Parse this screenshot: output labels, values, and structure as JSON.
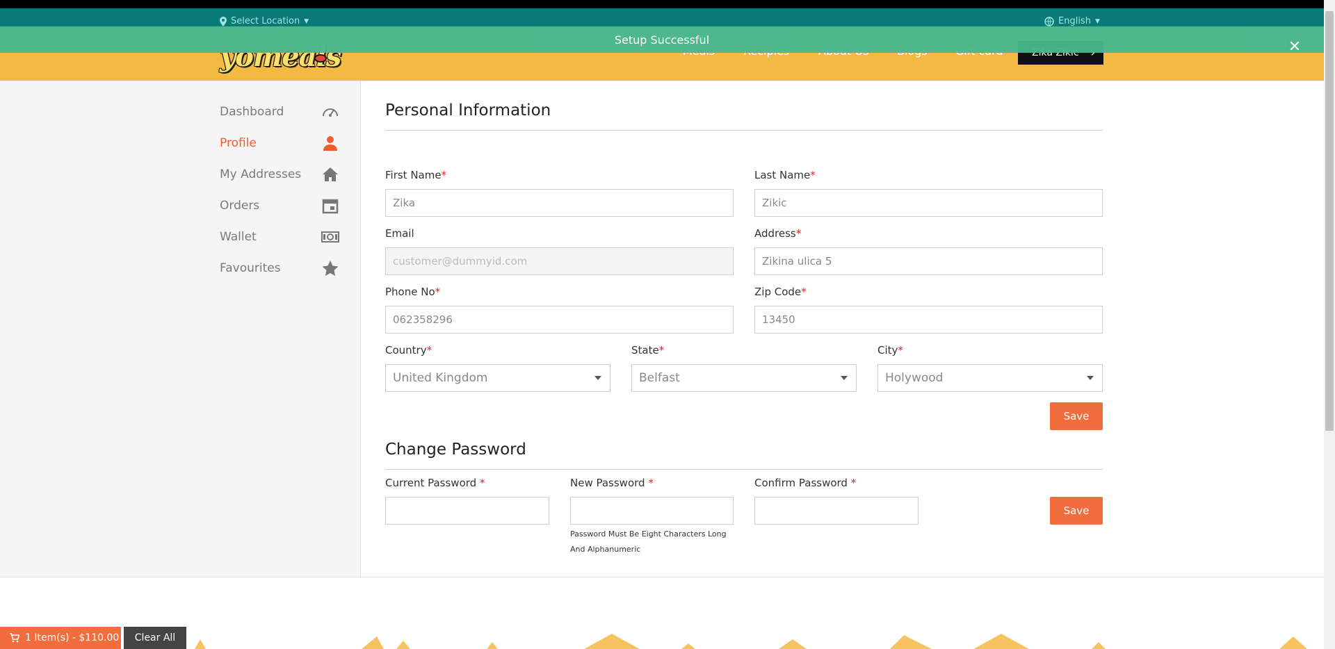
{
  "topbar": {
    "location_label": "Select Location",
    "language_label": "English"
  },
  "toast": {
    "message": "Setup Successful"
  },
  "header": {
    "logo_text": "yomeals",
    "nav": [
      "Meals",
      "Recipies",
      "About Us",
      "Blogs",
      "Gift card"
    ],
    "user_button": "Zika Zikic"
  },
  "sidebar": {
    "items": [
      {
        "label": "Dashboard",
        "icon": "speedometer-icon"
      },
      {
        "label": "Profile",
        "icon": "user-icon"
      },
      {
        "label": "My Addresses",
        "icon": "home-icon"
      },
      {
        "label": "Orders",
        "icon": "calendar-icon"
      },
      {
        "label": "Wallet",
        "icon": "money-icon"
      },
      {
        "label": "Favourites",
        "icon": "star-icon"
      }
    ]
  },
  "personal": {
    "title": "Personal Information",
    "first_name_label": "First Name",
    "first_name_value": "Zika",
    "last_name_label": "Last Name",
    "last_name_value": "Zikic",
    "email_label": "Email",
    "email_value": "customer@dummyid.com",
    "address_label": "Address",
    "address_value": "Zikina ulica 5",
    "phone_label": "Phone No",
    "phone_value": "062358296",
    "zip_label": "Zip Code",
    "zip_value": "13450",
    "country_label": "Country",
    "country_value": "United Kingdom",
    "state_label": "State",
    "state_value": "Belfast",
    "city_label": "City",
    "city_value": "Holywood",
    "save_label": "Save"
  },
  "password": {
    "title": "Change Password",
    "current_label": "Current Password",
    "new_label": "New Password",
    "confirm_label": "Confirm Password",
    "hint": "Password Must Be Eight Characters Long And Alphanumeric",
    "save_label": "Save"
  },
  "cart": {
    "summary": "1 Item(s) - $110.00",
    "clear_label": "Clear All"
  },
  "colors": {
    "accent": "#f26d3d",
    "header": "#f4b942",
    "toast": "#48b78e",
    "topbar": "#0a7a78"
  }
}
